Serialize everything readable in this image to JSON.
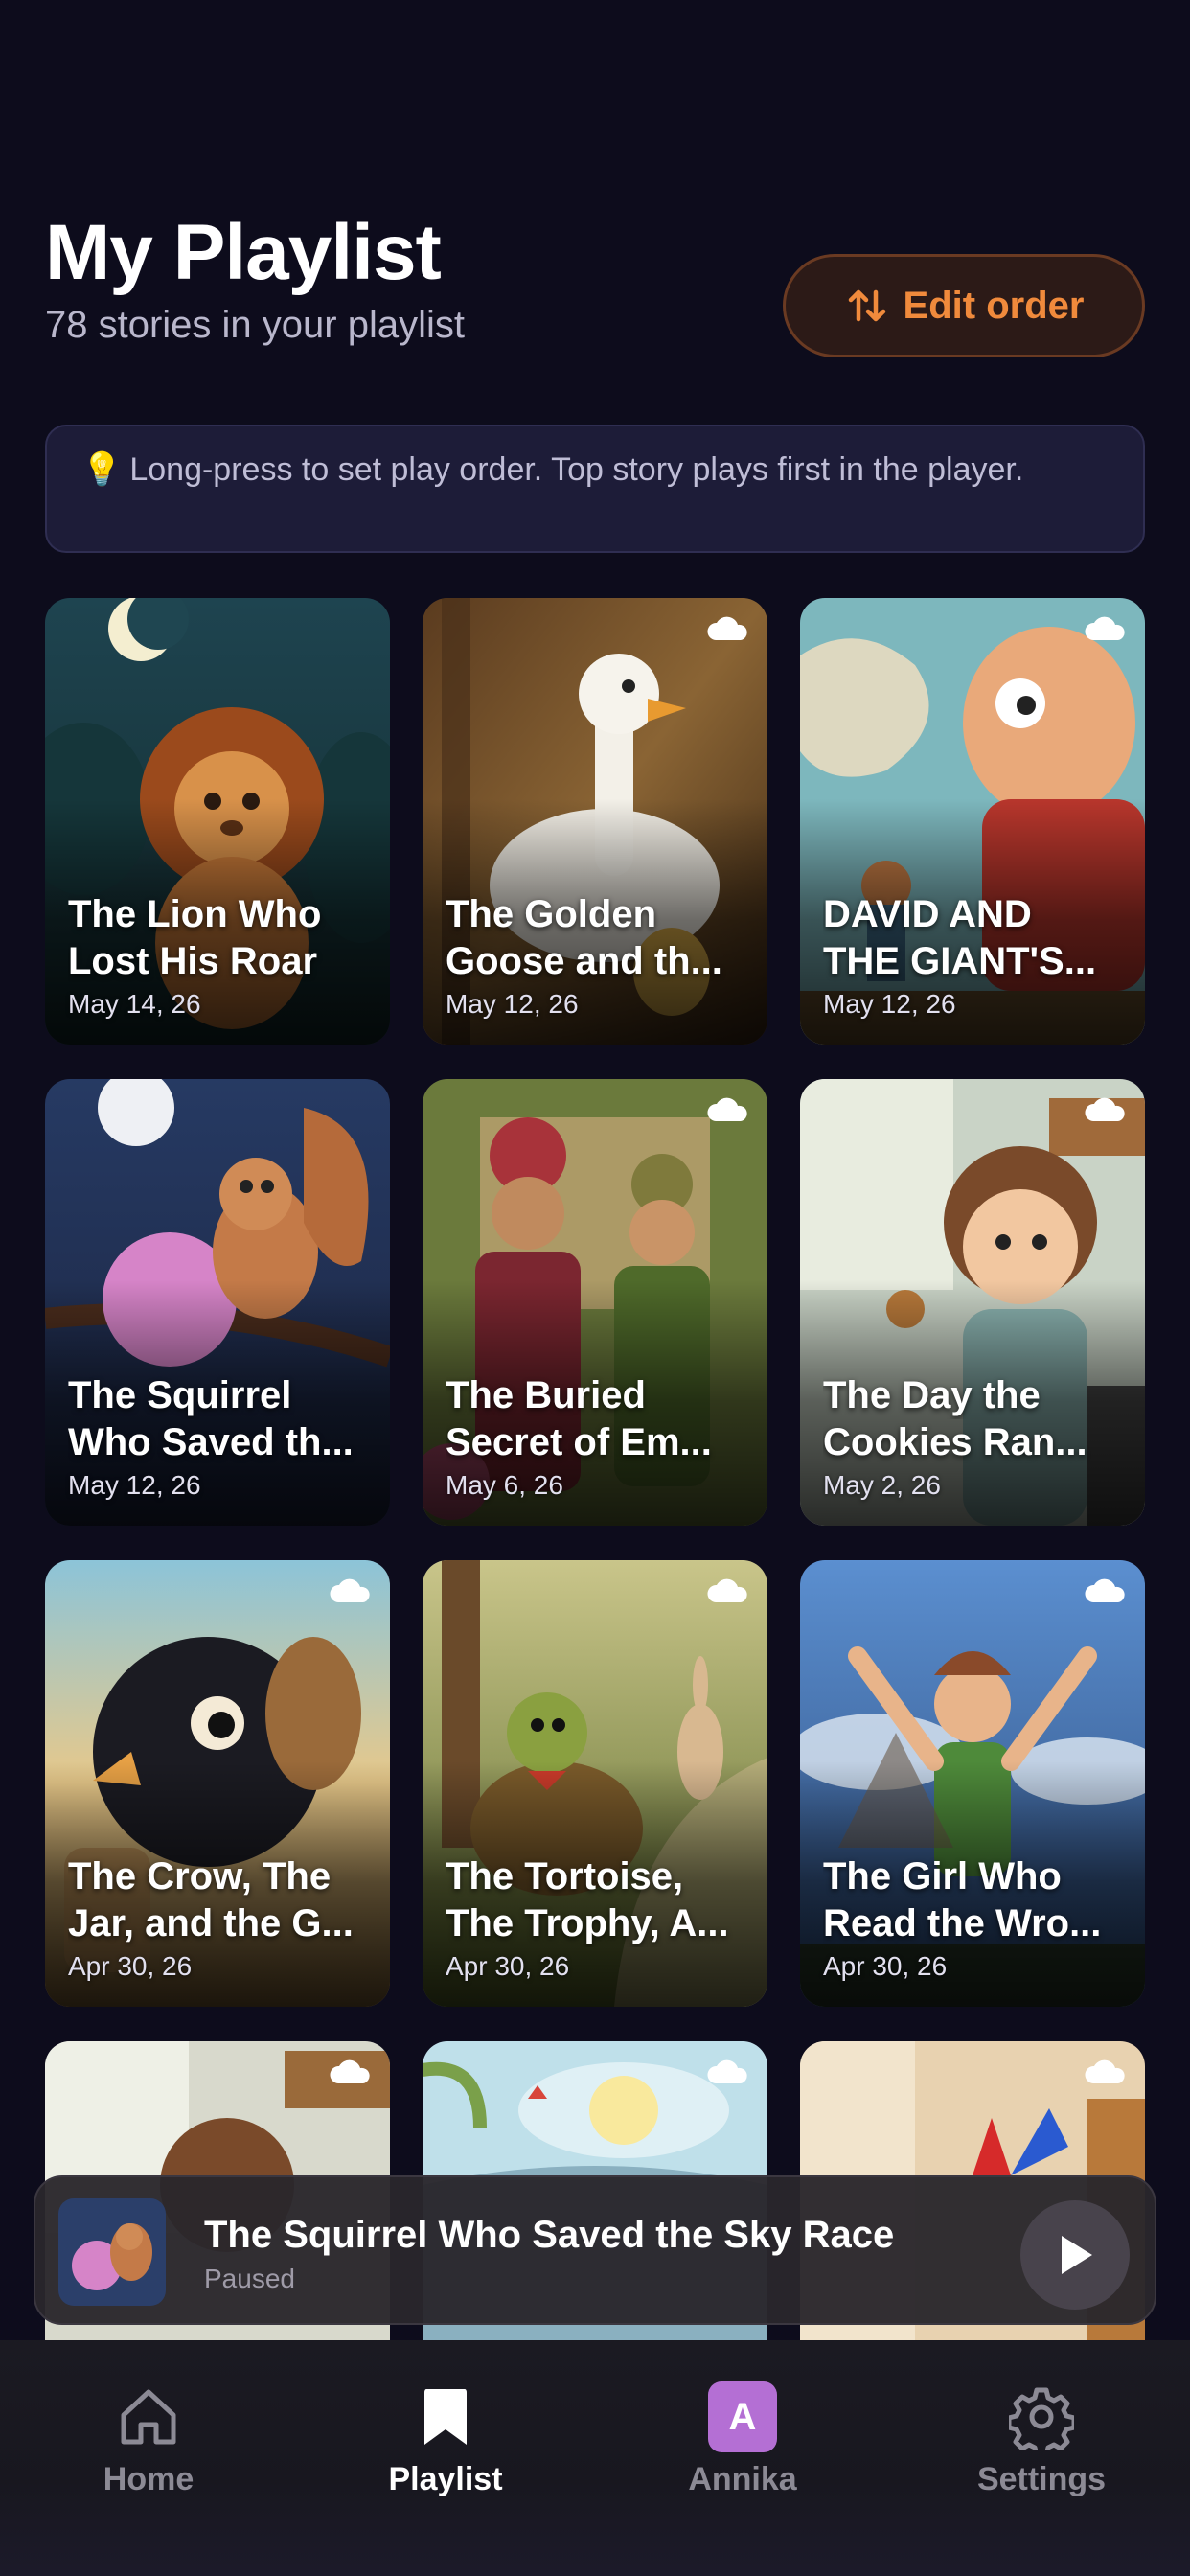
{
  "header": {
    "title": "My Playlist",
    "subtitle": "78 stories in your playlist",
    "edit_label": "Edit order"
  },
  "tip": {
    "text": "Long-press to set play order. Top story plays first in the player."
  },
  "stories": [
    {
      "line1": "The Lion Who",
      "line2": "Lost His Roar",
      "date": "May 14, 26",
      "cloud": false
    },
    {
      "line1": "The Golden",
      "line2": "Goose and th...",
      "date": "May 12, 26",
      "cloud": true
    },
    {
      "line1": "DAVID AND",
      "line2": "THE GIANT'S...",
      "date": "May 12, 26",
      "cloud": true
    },
    {
      "line1": "The Squirrel",
      "line2": "Who Saved th...",
      "date": "May 12, 26",
      "cloud": false
    },
    {
      "line1": "The Buried",
      "line2": "Secret of Em...",
      "date": "May 6, 26",
      "cloud": true
    },
    {
      "line1": "The Day the",
      "line2": "Cookies Ran...",
      "date": "May 2, 26",
      "cloud": true
    },
    {
      "line1": "The Crow, The",
      "line2": "Jar, and the G...",
      "date": "Apr 30, 26",
      "cloud": true
    },
    {
      "line1": "The Tortoise,",
      "line2": "The Trophy, A...",
      "date": "Apr 30, 26",
      "cloud": true
    },
    {
      "line1": "The Girl Who",
      "line2": "Read the Wro...",
      "date": "Apr 30, 26",
      "cloud": true
    },
    {
      "line1": "",
      "line2": "",
      "date": "",
      "cloud": true
    },
    {
      "line1": "",
      "line2": "",
      "date": "",
      "cloud": true
    },
    {
      "line1": "",
      "line2": "",
      "date": "",
      "cloud": true
    }
  ],
  "player": {
    "title": "The Squirrel Who Saved the Sky Race",
    "status": "Paused"
  },
  "tabs": [
    {
      "label": "Home",
      "icon": "home-icon"
    },
    {
      "label": "Playlist",
      "icon": "bookmark-icon",
      "active": true
    },
    {
      "label": "Annika",
      "icon": "avatar",
      "initial": "A"
    },
    {
      "label": "Settings",
      "icon": "gear-icon"
    }
  ],
  "colors": {
    "background": "#0d0c1c",
    "accent": "#f08a3c",
    "avatar": "#b46fd4"
  }
}
